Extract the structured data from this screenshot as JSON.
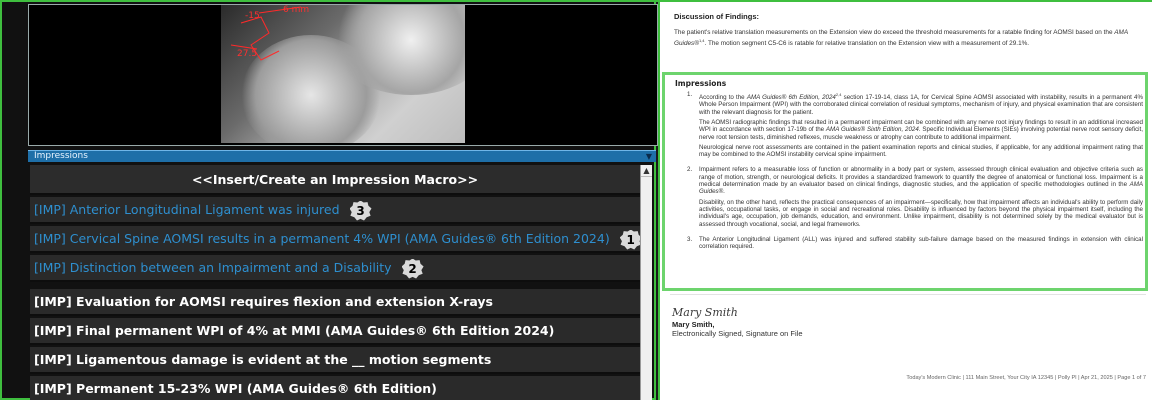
{
  "xray": {
    "labels": [
      "-15.",
      "6 mm",
      "27.5"
    ]
  },
  "impressions_panel": {
    "title": "Impressions",
    "insert_macro": "<<Insert/Create an Impression Macro>>",
    "items": [
      {
        "text": "[IMP] Anterior Longitudinal Ligament was injured",
        "badge": "3",
        "style": "link"
      },
      {
        "text": "[IMP] Cervical Spine AOMSI results in a permanent 4% WPI (AMA Guides® 6th Edition 2024)",
        "badge": "1",
        "style": "link"
      },
      {
        "text": "[IMP] Distinction between an Impairment and a Disability",
        "badge": "2",
        "style": "link"
      },
      {
        "text": "[IMP] Evaluation for AOMSI requires flexion and extension X-rays",
        "badge": "",
        "style": "normal"
      },
      {
        "text": "[IMP] Final permanent WPI of 4% at MMI (AMA Guides® 6th Edition 2024)",
        "badge": "",
        "style": "normal"
      },
      {
        "text": "[IMP] Ligamentous damage is evident at the __ motion segments",
        "badge": "",
        "style": "normal"
      },
      {
        "text": "[IMP] Permanent 15-23% WPI (AMA Guides® 6th Edition)",
        "badge": "",
        "style": "normal"
      }
    ]
  },
  "report": {
    "discussion_title": "Discussion of Findings:",
    "discussion_text_1": "The patient's relative translation measurements on the Extension view do exceed the threshold measurements for a ratable finding for AOMSI based on the ",
    "discussion_guides": "AMA Guides®",
    "discussion_sup": "1,4",
    "discussion_text_2": ". The motion segment C5-C6 is ratable for relative translation on the Extension view with a measurement of 29.1%.",
    "impressions_title": "Impressions",
    "imp1_num": "1.",
    "imp1_p1_a": "According to the ",
    "imp1_p1_guides": "AMA Guides® 6th Edition, 2024",
    "imp1_p1_sup": "2,4",
    "imp1_p1_b": " section 17-19-14, class 1A, for Cervical Spine AOMSI associated with instability, results in a permanent 4% Whole Person Impairment (WPI) with the corroborated clinical correlation of residual symptoms, mechanism of injury, and physical examination that are consistent with the relevant diagnosis for the patient.",
    "imp1_p2_a": "The AOMSI radiographic findings that resulted in a permanent impairment can be combined with any nerve root injury findings to result in an additional increased WPI in accordance with section 17-19b of the ",
    "imp1_p2_guides": "AMA Guides® Sixth Edition, 2024",
    "imp1_p2_b": ". Specific Individual Elements (SIEs) involving potential nerve root sensory deficit, nerve root tension tests, diminished reflexes, muscle weakness or atrophy can contribute to additional impairment.",
    "imp1_p3": "Neurological nerve root assessments are contained in the patient examination reports and clinical studies, if applicable, for any additional impairment rating that may be combined to the AOMSI instability cervical spine impairment.",
    "imp2_num": "2.",
    "imp2_p1_a": "Impairment refers to a measurable loss of function or abnormality in a body part or system, assessed through clinical evaluation and objective criteria such as range of motion, strength, or neurological deficits. It provides a standardized framework to quantify the degree of anatomical or functional loss. Impairment is a medical determination made by an evaluator based on clinical findings, diagnostic studies, and the application of specific methodologies outlined in the ",
    "imp2_p1_guides": "AMA Guides®",
    "imp2_p1_b": ".",
    "imp2_p2": "Disability, on the other hand, reflects the practical consequences of an impairment—specifically, how that impairment affects an individual's ability to perform daily activities, occupational tasks, or engage in social and recreational roles. Disability is influenced by factors beyond the physical impairment itself, including the individual's age, occupation, job demands, education, and environment. Unlike impairment, disability is not determined solely by the medical evaluator but is assessed through vocational, social, and legal frameworks.",
    "imp3_num": "3.",
    "imp3_p1": "The Anterior Longitudinal Ligament (ALL) was injured and suffered stability sub-failure damage based on the measured findings in extension with clinical correlation required.",
    "signature_script": "Mary Smith",
    "signature_name": "Mary Smith,",
    "signature_line": "Electronically Signed, Signature on File",
    "footer": "Today's Modern Clinic | 111 Main Street, Your City IA 12345 | Polly Pl | Apr 21, 2025 | Page 1 of 7"
  },
  "colors": {
    "accent_green": "#3fbf3f",
    "link_blue": "#2e8fcf",
    "panel_blue": "#1e6fa8"
  }
}
